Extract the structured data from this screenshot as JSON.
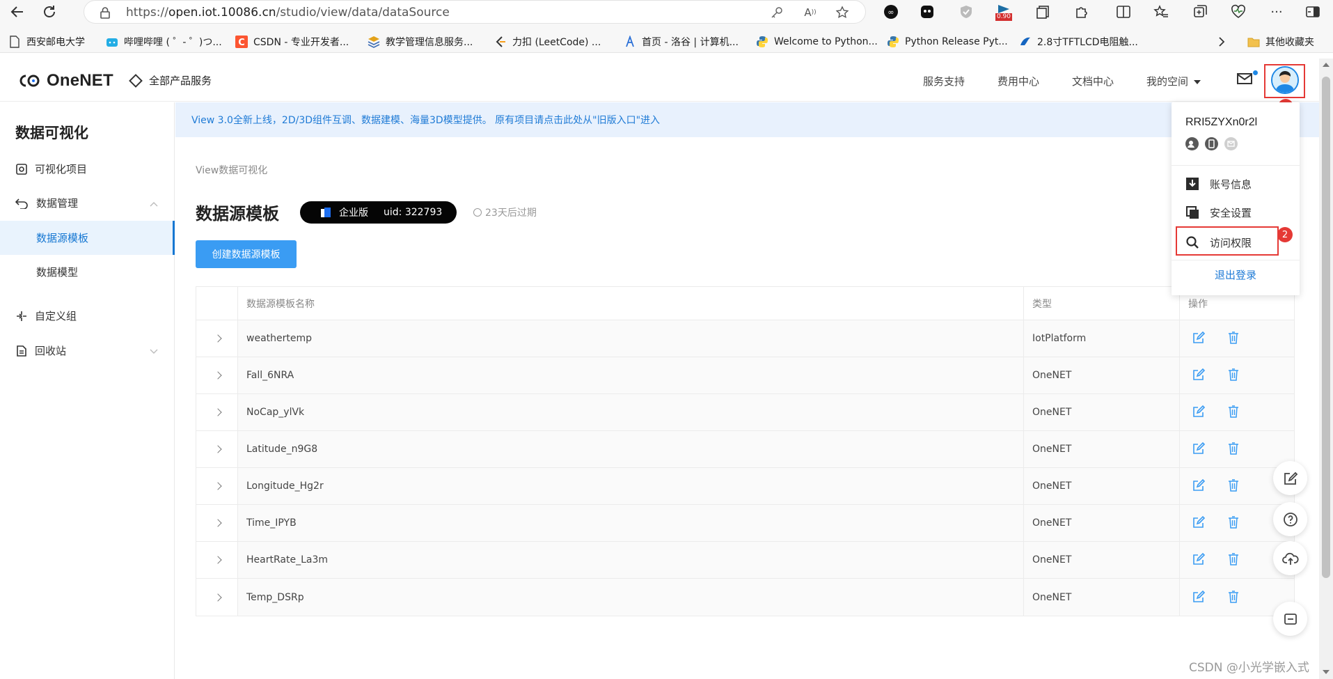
{
  "browser": {
    "url_prefix": "https://",
    "url_host": "open.iot.10086.cn",
    "url_path": "/studio/view/data/dataSource",
    "ext_badge": "0.90",
    "more_label": "···"
  },
  "bookmarks": [
    {
      "label": "西安邮电大学"
    },
    {
      "label": "哔哩哔哩 ( ゜- ゜)つ..."
    },
    {
      "label": "CSDN - 专业开发者..."
    },
    {
      "label": "教学管理信息服务..."
    },
    {
      "label": "力扣 (LeetCode) ..."
    },
    {
      "label": "首页 - 洛谷 | 计算机..."
    },
    {
      "label": "Welcome to Python..."
    },
    {
      "label": "Python Release Pyt..."
    },
    {
      "label": "2.8寸TFTLCD电阻触..."
    }
  ],
  "bookmarks_other": "其他收藏夹",
  "header": {
    "logo_text": "OneNET",
    "all_products": "全部产品服务",
    "links": [
      "服务支持",
      "费用中心",
      "文档中心"
    ],
    "my_space": "我的空间"
  },
  "sidebar": {
    "title": "数据可视化",
    "items": [
      {
        "label": "可视化项目"
      },
      {
        "label": "数据管理"
      },
      {
        "label": "数据源模板"
      },
      {
        "label": "数据模型"
      },
      {
        "label": "自定义组"
      },
      {
        "label": "回收站"
      }
    ]
  },
  "notice": "View 3.0全新上线，2D/3D组件互调、数据建模、海量3D模型提供。 原有项目请点击此处从\"旧版入口\"进入",
  "main": {
    "breadcrumb": "View数据可视化",
    "title": "数据源模板",
    "edition": "企业版",
    "uid": "uid: 322793",
    "expire": "23天后过期",
    "create_button": "创建数据源模板"
  },
  "table": {
    "headers": [
      "数据源模板名称",
      "类型",
      "操作"
    ],
    "rows": [
      {
        "name": "weathertemp",
        "type": "IotPlatform"
      },
      {
        "name": "Fall_6NRA",
        "type": "OneNET"
      },
      {
        "name": "NoCap_ylVk",
        "type": "OneNET"
      },
      {
        "name": "Latitude_n9G8",
        "type": "OneNET"
      },
      {
        "name": "Longitude_Hg2r",
        "type": "OneNET"
      },
      {
        "name": "Time_IPYB",
        "type": "OneNET"
      },
      {
        "name": "HeartRate_La3m",
        "type": "OneNET"
      },
      {
        "name": "Temp_DSRp",
        "type": "OneNET"
      }
    ]
  },
  "dropdown": {
    "username": "RRI5ZYXn0r2l",
    "items": [
      "账号信息",
      "安全设置",
      "访问权限"
    ],
    "logout": "退出登录"
  },
  "annotations": {
    "badge1": "1",
    "badge2": "2"
  },
  "watermark": "CSDN @小光学嵌入式",
  "colors": {
    "accent": "#1677d2",
    "button": "#3a9cf3",
    "highlight": "#e53935"
  }
}
